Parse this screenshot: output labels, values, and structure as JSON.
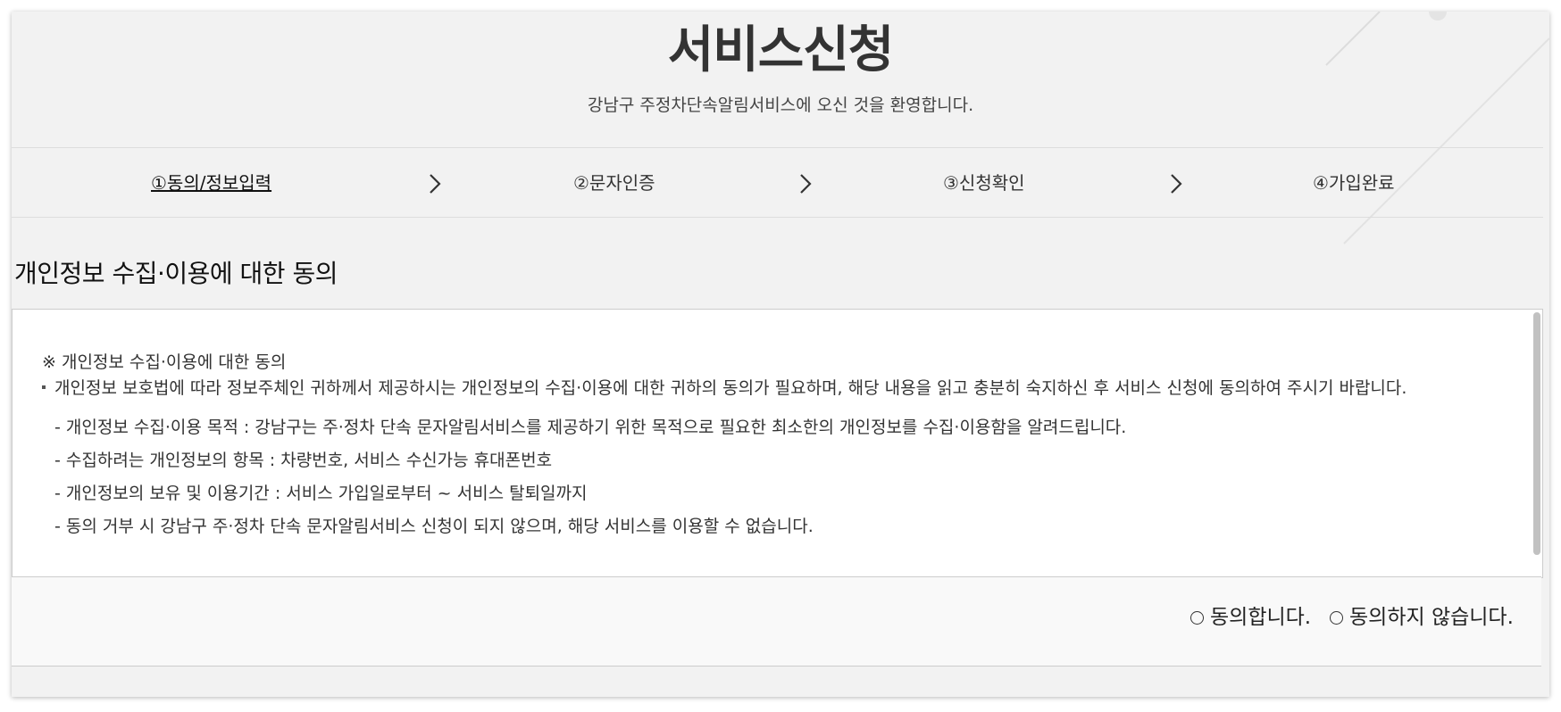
{
  "header": {
    "title": "서비스신청",
    "subtitle": "강남구 주정차단속알림서비스에 오신 것을 환영합니다."
  },
  "steps": [
    {
      "label": "①동의/정보입력",
      "active": true
    },
    {
      "label": "②문자인증",
      "active": false
    },
    {
      "label": "③신청확인",
      "active": false
    },
    {
      "label": "④가입완료",
      "active": false
    }
  ],
  "consent": {
    "section_title": "개인정보 수집·이용에 대한 동의",
    "heading": "※ 개인정보 수집·이용에 대한 동의",
    "bullet": "개인정보 보호법에 따라 정보주체인 귀하께서 제공하시는 개인정보의 수집·이용에 대한 귀하의 동의가 필요하며, 해당 내용을 읽고 충분히 숙지하신 후 서비스 신청에 동의하여 주시기 바랍니다.",
    "items": [
      "- 개인정보 수집·이용 목적 : 강남구는 주·정차 단속 문자알림서비스를 제공하기 위한 목적으로 필요한 최소한의 개인정보를 수집·이용함을 알려드립니다.",
      "- 수집하려는 개인정보의 항목 : 차량번호, 서비스 수신가능 휴대폰번호",
      "- 개인정보의 보유 및 이용기간 : 서비스 가입일로부터 ~ 서비스 탈퇴일까지",
      "- 동의 거부 시 강남구 주·정차 단속 문자알림서비스 신청이 되지 않으며, 해당 서비스를 이용할 수 없습니다."
    ]
  },
  "options": {
    "agree_label": "동의합니다.",
    "disagree_label": "동의하지 않습니다."
  },
  "colors": {
    "page_background": "#f2f2f2",
    "box_background": "#ffffff",
    "text": "#333333",
    "border": "#cccccc"
  },
  "icons": {
    "step_separator": "chevron-right-icon",
    "radio": "radio-unchecked-icon"
  }
}
